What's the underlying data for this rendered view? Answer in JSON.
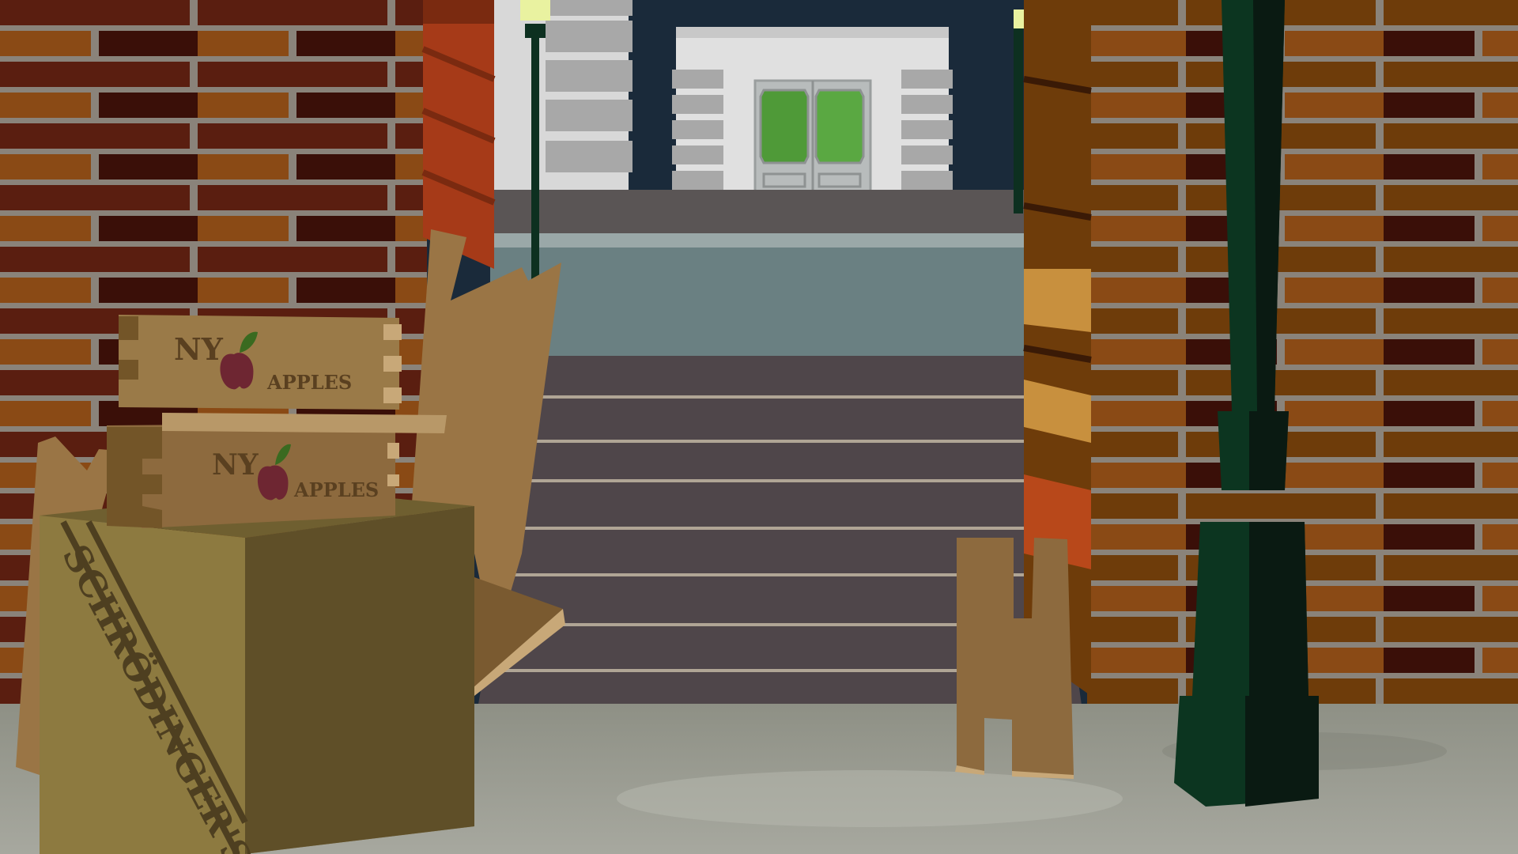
{
  "crates": {
    "top": {
      "line1": "NY",
      "line2": "APPLES"
    },
    "bottom": {
      "line1": "NY",
      "line2": "APPLES"
    }
  },
  "box_label": "SCHRÖDINGER'S",
  "colors": {
    "night_sky": "#1a2a3a",
    "brick_grout": "#8a837a",
    "sidewalk": "#9a9b92",
    "lamp_post": "#0d1f16",
    "lamp_glow": "#e9f2a0",
    "door_glass": "#4f9a38",
    "cardboard": "#8d6a3e",
    "apple": "#6e2632"
  }
}
